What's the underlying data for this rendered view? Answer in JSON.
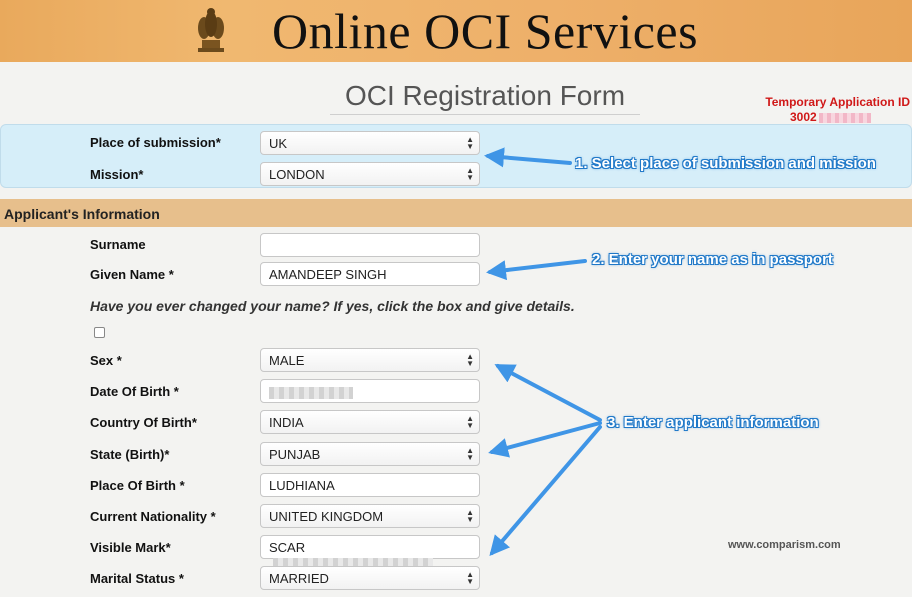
{
  "banner": {
    "title": "Online OCI Services"
  },
  "form": {
    "title": "OCI Registration Form",
    "temporary_id_label": "Temporary Application ID",
    "temporary_id_prefix": "3002"
  },
  "mission_panel": {
    "place_label": "Place of submission*",
    "place_value": "UK",
    "mission_label": "Mission*",
    "mission_value": "LONDON"
  },
  "applicant": {
    "section_title": "Applicant's Information",
    "surname_label": "Surname",
    "surname_value": "",
    "given_name_label": "Given Name *",
    "given_name_value": "AMANDEEP SINGH",
    "name_change_question": "Have you ever changed your name? If yes, click the box and give details.",
    "sex_label": "Sex *",
    "sex_value": "MALE",
    "dob_label": "Date Of Birth *",
    "country_birth_label": "Country Of Birth*",
    "country_birth_value": "INDIA",
    "state_birth_label": "State (Birth)*",
    "state_birth_value": "PUNJAB",
    "place_birth_label": "Place Of Birth *",
    "place_birth_value": "LUDHIANA",
    "nationality_label": "Current Nationality *",
    "nationality_value": "UNITED KINGDOM",
    "visible_mark_label": "Visible Mark*",
    "visible_mark_value": "SCAR",
    "marital_label": "Marital Status *",
    "marital_value": "MARRIED"
  },
  "callouts": {
    "step1": "1. Select place of submission and mission",
    "step2": "2. Enter your name as in passport",
    "step3": "3. Enter applicant information"
  },
  "watermark": "www.comparism.com",
  "colors": {
    "banner": "#eeb06a",
    "section_bar": "#e7bf8c",
    "mission_panel": "#d6eef9",
    "callout_blue": "#1f78c8",
    "temporary_id_red": "#d01818"
  },
  "icons": [
    "emblem-icon",
    "select-arrows-icon",
    "checkbox-icon",
    "arrow-pointer-icon"
  ]
}
